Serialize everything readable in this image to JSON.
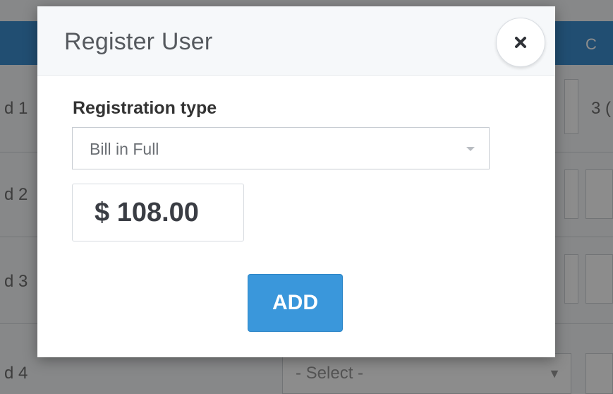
{
  "background": {
    "row_labels": [
      "d 1",
      "d 2",
      "d 3",
      "d 4"
    ],
    "row2_partial": "3 (",
    "select_placeholder": "- Select -",
    "header_partial": "C"
  },
  "modal": {
    "title": "Register User",
    "close_icon": "close-icon",
    "registration_type_label": "Registration type",
    "registration_type_value": "Bill in Full",
    "amount": "$ 108.00",
    "add_label": "ADD"
  },
  "colors": {
    "accent": "#3a97db",
    "header_bg": "#3d8fd0"
  }
}
